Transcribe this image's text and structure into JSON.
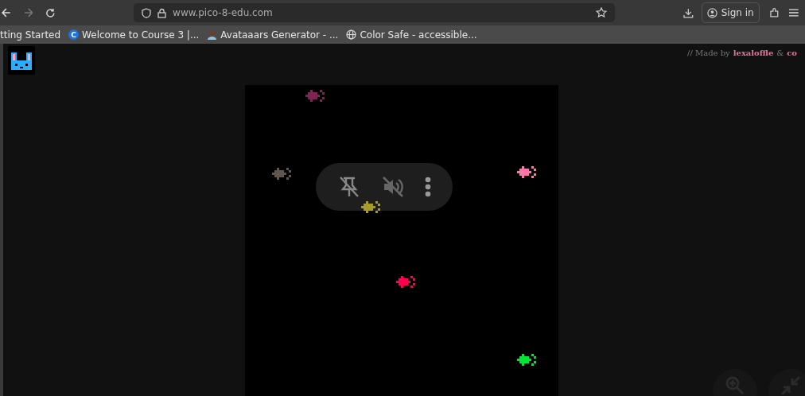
{
  "browser": {
    "url": "www.pico-8-edu.com",
    "sign_in": "Sign in"
  },
  "bookmarks": [
    {
      "label": "tting Started",
      "kind": "none"
    },
    {
      "label": "Welcome to Course 3 |...",
      "kind": "letter",
      "badge": "C"
    },
    {
      "label": "Avataaars Generator - ...",
      "kind": "avatar"
    },
    {
      "label": "Color Safe - accessible...",
      "kind": "globe"
    }
  ],
  "credit": {
    "prefix": "// Made by",
    "author": "lexaloffle",
    "joiner": "&",
    "coauthor": "co"
  },
  "fish": [
    {
      "color": "#7e2553"
    },
    {
      "color": "#5f574f"
    },
    {
      "color": "#ff77a8"
    },
    {
      "color": "#a89b2a"
    },
    {
      "color": "#ff004d"
    },
    {
      "color": "#00e436"
    }
  ]
}
